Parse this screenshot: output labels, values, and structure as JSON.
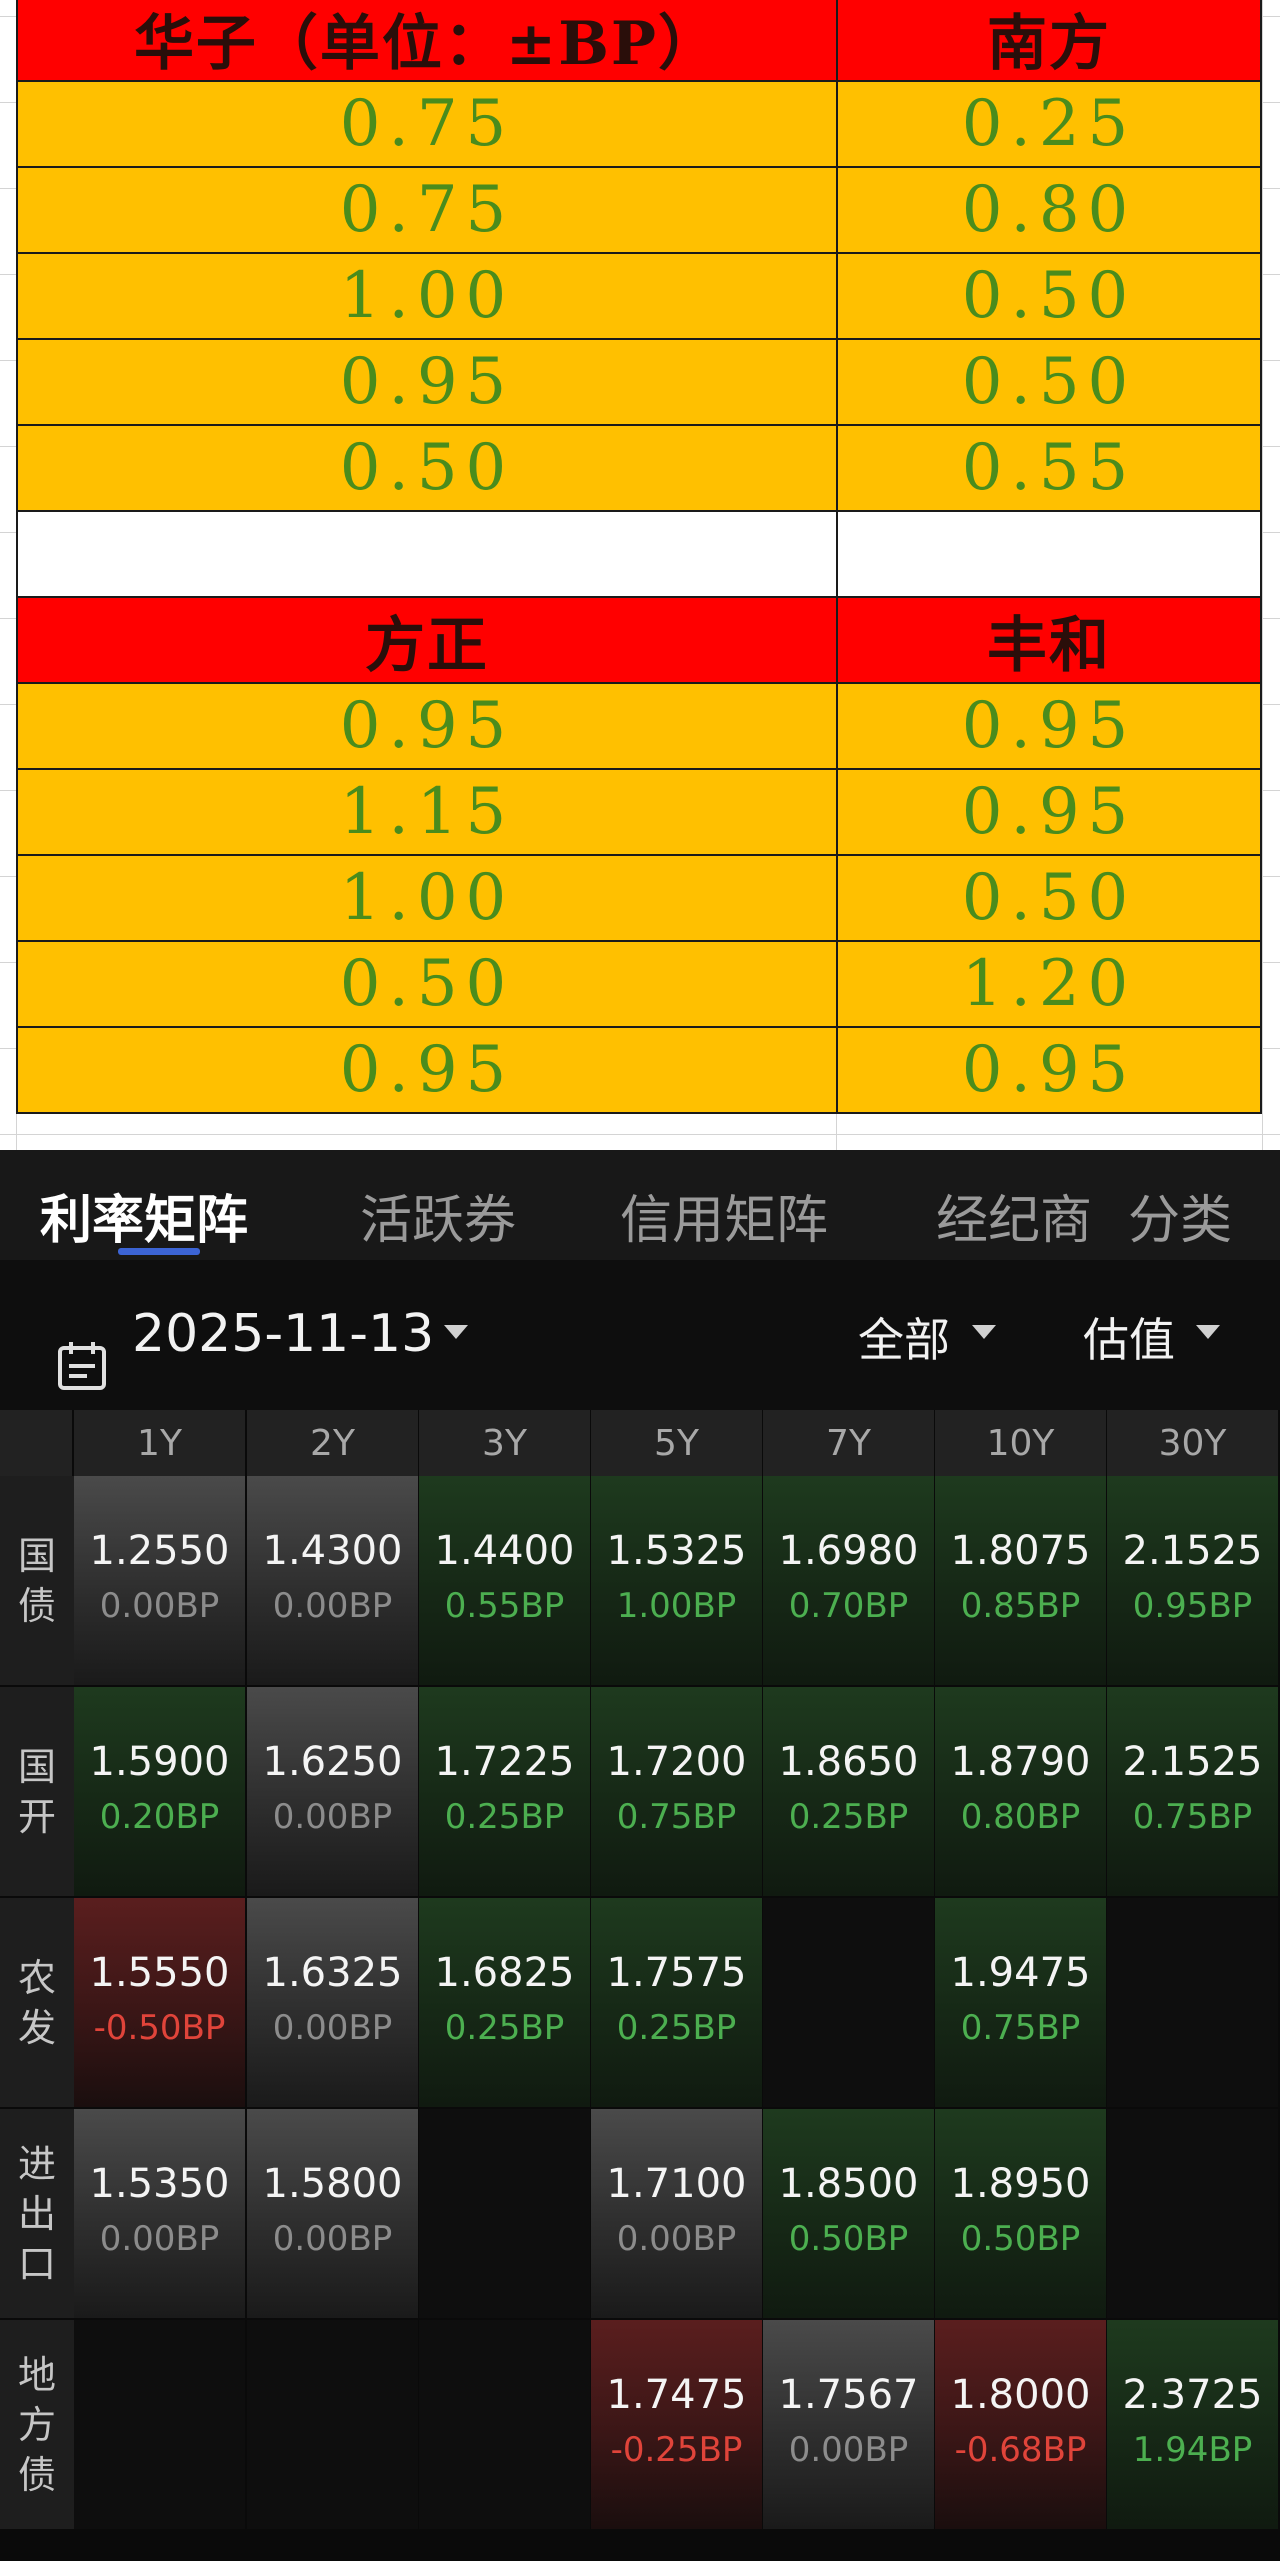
{
  "sheet": {
    "blocks": [
      {
        "headers": [
          "华子（单位：±BP）",
          "南方"
        ],
        "rows": [
          [
            "0.75",
            "0.25"
          ],
          [
            "0.75",
            "0.80"
          ],
          [
            "1.00",
            "0.50"
          ],
          [
            "0.95",
            "0.50"
          ],
          [
            "0.50",
            "0.55"
          ]
        ]
      },
      {
        "headers": [
          "方正",
          "丰和"
        ],
        "rows": [
          [
            "0.95",
            "0.95"
          ],
          [
            "1.15",
            "0.95"
          ],
          [
            "1.00",
            "0.50"
          ],
          [
            "0.50",
            "1.20"
          ],
          [
            "0.95",
            "0.95"
          ]
        ]
      }
    ],
    "colors": {
      "header_bg": "#ff0000",
      "value_bg": "#ffc000",
      "value_text": "#4a8c1c"
    }
  },
  "app": {
    "tabs": [
      "利率矩阵",
      "活跃券",
      "信用矩阵",
      "经纪商",
      "分类"
    ],
    "active_tab": 0,
    "date": "2025-11-13",
    "filter_scope": "全部",
    "filter_metric": "估值",
    "tenors": [
      "1Y",
      "2Y",
      "3Y",
      "5Y",
      "7Y",
      "10Y",
      "30Y"
    ],
    "matrix": [
      {
        "label": "国\n债",
        "cells": [
          {
            "y": "1.2550",
            "c": "0.00BP",
            "d": "flat"
          },
          {
            "y": "1.4300",
            "c": "0.00BP",
            "d": "flat"
          },
          {
            "y": "1.4400",
            "c": "0.55BP",
            "d": "up"
          },
          {
            "y": "1.5325",
            "c": "1.00BP",
            "d": "up"
          },
          {
            "y": "1.6980",
            "c": "0.70BP",
            "d": "up"
          },
          {
            "y": "1.8075",
            "c": "0.85BP",
            "d": "up"
          },
          {
            "y": "2.1525",
            "c": "0.95BP",
            "d": "up"
          }
        ]
      },
      {
        "label": "国\n开",
        "cells": [
          {
            "y": "1.5900",
            "c": "0.20BP",
            "d": "up"
          },
          {
            "y": "1.6250",
            "c": "0.00BP",
            "d": "flat"
          },
          {
            "y": "1.7225",
            "c": "0.25BP",
            "d": "up"
          },
          {
            "y": "1.7200",
            "c": "0.75BP",
            "d": "up"
          },
          {
            "y": "1.8650",
            "c": "0.25BP",
            "d": "up"
          },
          {
            "y": "1.8790",
            "c": "0.80BP",
            "d": "up"
          },
          {
            "y": "2.1525",
            "c": "0.75BP",
            "d": "up"
          }
        ]
      },
      {
        "label": "农\n发",
        "cells": [
          {
            "y": "1.5550",
            "c": "-0.50BP",
            "d": "down"
          },
          {
            "y": "1.6325",
            "c": "0.00BP",
            "d": "flat"
          },
          {
            "y": "1.6825",
            "c": "0.25BP",
            "d": "up"
          },
          {
            "y": "1.7575",
            "c": "0.25BP",
            "d": "up"
          },
          {
            "y": "",
            "c": "",
            "d": "empty"
          },
          {
            "y": "1.9475",
            "c": "0.75BP",
            "d": "up"
          },
          {
            "y": "",
            "c": "",
            "d": "empty"
          }
        ]
      },
      {
        "label": "进\n出\n口",
        "cells": [
          {
            "y": "1.5350",
            "c": "0.00BP",
            "d": "flat"
          },
          {
            "y": "1.5800",
            "c": "0.00BP",
            "d": "flat"
          },
          {
            "y": "",
            "c": "",
            "d": "empty"
          },
          {
            "y": "1.7100",
            "c": "0.00BP",
            "d": "flat"
          },
          {
            "y": "1.8500",
            "c": "0.50BP",
            "d": "up"
          },
          {
            "y": "1.8950",
            "c": "0.50BP",
            "d": "up"
          },
          {
            "y": "",
            "c": "",
            "d": "empty"
          }
        ]
      },
      {
        "label": "地\n方\n债",
        "cells": [
          {
            "y": "",
            "c": "",
            "d": "empty"
          },
          {
            "y": "",
            "c": "",
            "d": "empty"
          },
          {
            "y": "",
            "c": "",
            "d": "empty"
          },
          {
            "y": "1.7475",
            "c": "-0.25BP",
            "d": "down"
          },
          {
            "y": "1.7567",
            "c": "0.00BP",
            "d": "flat"
          },
          {
            "y": "1.8000",
            "c": "-0.68BP",
            "d": "down"
          },
          {
            "y": "2.3725",
            "c": "1.94BP",
            "d": "up"
          }
        ]
      }
    ]
  }
}
